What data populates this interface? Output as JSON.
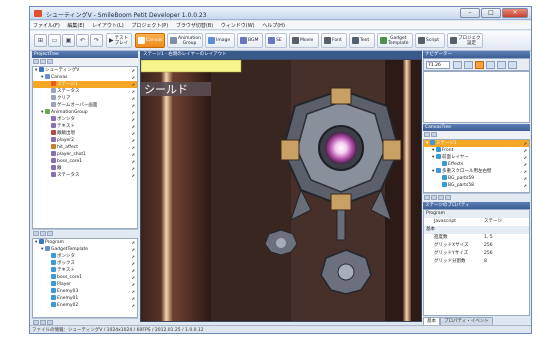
{
  "window": {
    "title": "シューティングV - SmileBoom Petit Developer 1.0.0.23",
    "controls": [
      "–",
      "□",
      "×"
    ]
  },
  "menu": [
    "ファイル(F)",
    "編集(E)",
    "レイアウト(L)",
    "プロジェクト(P)",
    "ブラウザ切替(B)",
    "ウィンドウ(W)",
    "ヘルプ(H)"
  ],
  "toolbar": {
    "test_play": "テスト\nプレイ",
    "buttons": [
      "Canvas",
      "Animation\nGroup",
      "Image",
      "BGM",
      "SE",
      "Movie",
      "Font",
      "Text",
      "Gadget\nTemplate",
      "Script",
      "プロジェクト\n設定"
    ]
  },
  "project_tree": {
    "header": "ProjectTree",
    "items": [
      {
        "label": "シューティングV",
        "indent": 0,
        "color": "#3b73c9",
        "selected": false
      },
      {
        "label": "Canvas",
        "indent": 1,
        "color": "#6a8fd1",
        "selected": false
      },
      {
        "label": "ステージ1",
        "indent": 2,
        "color": "#e85a2a",
        "selected": true
      },
      {
        "label": "ステータス",
        "indent": 2,
        "color": "#9aa6b8",
        "selected": false
      },
      {
        "label": "クリア",
        "indent": 2,
        "color": "#9aa6b8",
        "selected": false
      },
      {
        "label": "ゲームオーバー画面",
        "indent": 2,
        "color": "#9aa6b8",
        "selected": false
      },
      {
        "label": "AnimationGroup",
        "indent": 1,
        "color": "#6aa84f",
        "selected": false
      },
      {
        "label": "ボンシタ",
        "indent": 2,
        "color": "#8a6fb8",
        "selected": false
      },
      {
        "label": "テキスト",
        "indent": 2,
        "color": "#8a6fb8",
        "selected": false
      },
      {
        "label": "敵敵出現",
        "indent": 2,
        "color": "#b04a3a",
        "selected": false
      },
      {
        "label": "player2",
        "indent": 2,
        "color": "#8a6fb8",
        "selected": false
      },
      {
        "label": "hit_affect",
        "indent": 2,
        "color": "#c08030",
        "selected": false
      },
      {
        "label": "player_shot1",
        "indent": 2,
        "color": "#8a6fb8",
        "selected": false
      },
      {
        "label": "boss_core1",
        "indent": 2,
        "color": "#8a6fb8",
        "selected": false
      },
      {
        "label": "敵",
        "indent": 2,
        "color": "#8a6fb8",
        "selected": false
      },
      {
        "label": "ステータス",
        "indent": 2,
        "color": "#8a6fb8",
        "selected": false
      }
    ]
  },
  "program_tree": {
    "items": [
      {
        "label": "Program",
        "indent": 0,
        "color": "#3b73c9"
      },
      {
        "label": "GadgetTemplate",
        "indent": 1,
        "color": "#6a8fd1"
      },
      {
        "label": "ボンシタ",
        "indent": 2,
        "color": "#3a9ad9"
      },
      {
        "label": "ボックス",
        "indent": 2,
        "color": "#3a9ad9"
      },
      {
        "label": "テキスト",
        "indent": 2,
        "color": "#3a9ad9"
      },
      {
        "label": "boss_core1",
        "indent": 2,
        "color": "#3a9ad9"
      },
      {
        "label": "Player",
        "indent": 2,
        "color": "#3a9ad9"
      },
      {
        "label": "Enemy03",
        "indent": 2,
        "color": "#3a9ad9"
      },
      {
        "label": "Enemy01",
        "indent": 2,
        "color": "#3a9ad9"
      },
      {
        "label": "Enemy02",
        "indent": 2,
        "color": "#3a9ad9"
      }
    ]
  },
  "stage": {
    "path": "ステージ1 - 右側のレイヤーのレイアウト",
    "label": "シールド"
  },
  "navigator": {
    "header": "ナビゲーター",
    "zoom": "71.26"
  },
  "canvas_tree": {
    "header": "CanvasTree",
    "items": [
      {
        "label": "ステージ1",
        "indent": 0,
        "selected": true
      },
      {
        "label": "Front",
        "indent": 1,
        "selected": false
      },
      {
        "label": "前面レイヤー",
        "indent": 1,
        "selected": false
      },
      {
        "label": "Effects",
        "indent": 2,
        "selected": false
      },
      {
        "label": "多重スクロール用左右壁",
        "indent": 1,
        "selected": false
      },
      {
        "label": "BG_parts59",
        "indent": 2,
        "selected": false
      },
      {
        "label": "BG_parts58",
        "indent": 2,
        "selected": false
      }
    ]
  },
  "properties": {
    "header": "ステージのプロパティ",
    "rows": [
      {
        "label": "Program",
        "value": ""
      },
      {
        "label": "Javascript",
        "value": "ステージ"
      },
      {
        "label": "基本",
        "value": ""
      },
      {
        "label": "進度数",
        "value": "1, 5"
      },
      {
        "label": "グリッドXサイズ",
        "value": "256"
      },
      {
        "label": "グリッドYサイズ",
        "value": "256"
      },
      {
        "label": "グリッド分割数",
        "value": "8"
      }
    ],
    "tabs": [
      "基本",
      "プロパティ・イベント"
    ]
  },
  "status": "ファイルの情報：シューティングV / 1024x1024 / 60FPS / 2012.01.25 / 1.0.0.12",
  "colors": {
    "titlebar": "#c9d8ee",
    "panel_header": "#4a6ba3",
    "active_tool": "#f08a1c",
    "selection": "#f5a623"
  }
}
